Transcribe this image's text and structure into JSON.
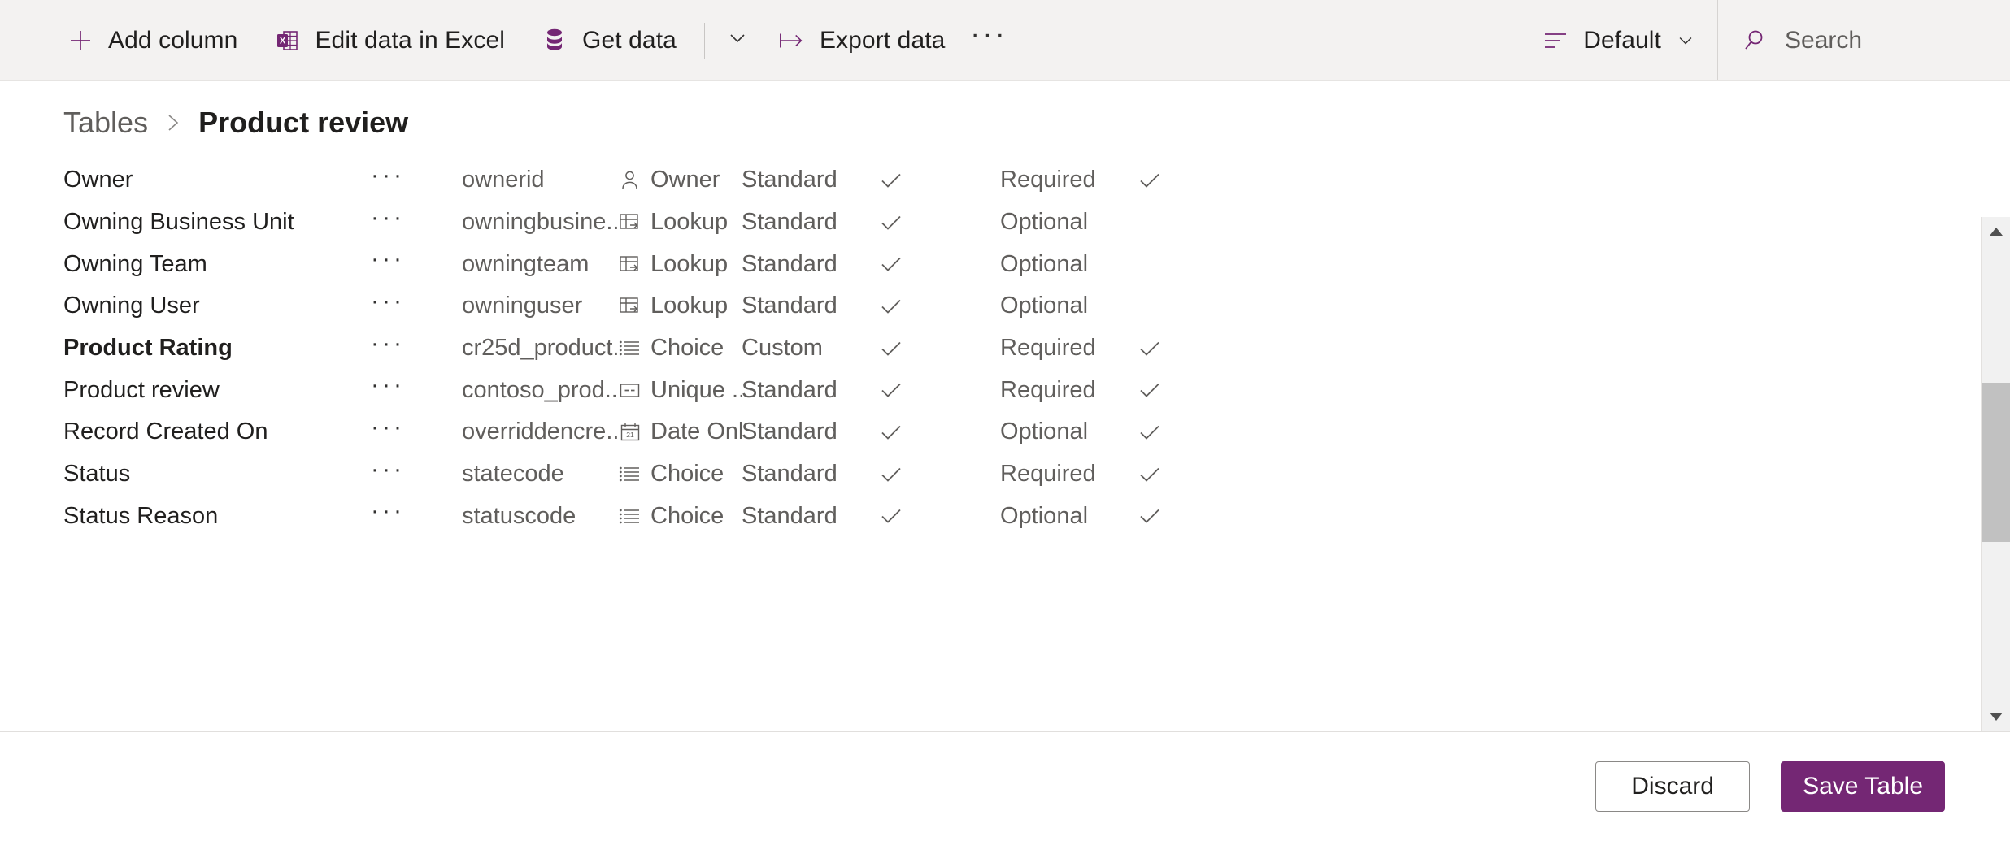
{
  "commandbar": {
    "add_column": "Add column",
    "edit_excel": "Edit data in Excel",
    "get_data": "Get data",
    "export_data": "Export data",
    "overflow": "···",
    "view_label": "Default",
    "search_placeholder": "Search"
  },
  "breadcrumb": {
    "root": "Tables",
    "separator": "›",
    "current": "Product review"
  },
  "grid": {
    "rows": [
      {
        "display_name": "Owner",
        "bold": false,
        "menu": "···",
        "logical_name": "ownerid",
        "data_type": "Owner",
        "type_icon": "person-icon",
        "custom_type": "Standard",
        "check1": true,
        "required": "Required",
        "check2": true
      },
      {
        "display_name": "Owning Business Unit",
        "bold": false,
        "menu": "···",
        "logical_name": "owningbusine...",
        "data_type": "Lookup",
        "type_icon": "lookup-icon",
        "custom_type": "Standard",
        "check1": true,
        "required": "Optional",
        "check2": false
      },
      {
        "display_name": "Owning Team",
        "bold": false,
        "menu": "···",
        "logical_name": "owningteam",
        "data_type": "Lookup",
        "type_icon": "lookup-icon",
        "custom_type": "Standard",
        "check1": true,
        "required": "Optional",
        "check2": false
      },
      {
        "display_name": "Owning User",
        "bold": false,
        "menu": "···",
        "logical_name": "owninguser",
        "data_type": "Lookup",
        "type_icon": "lookup-icon",
        "custom_type": "Standard",
        "check1": true,
        "required": "Optional",
        "check2": false
      },
      {
        "display_name": "Product Rating",
        "bold": true,
        "menu": "···",
        "logical_name": "cr25d_product...",
        "data_type": "Choice",
        "type_icon": "choice-icon",
        "custom_type": "Custom",
        "check1": true,
        "required": "Required",
        "check2": true
      },
      {
        "display_name": "Product review",
        "bold": false,
        "menu": "···",
        "logical_name": "contoso_prod...",
        "data_type": "Unique ...",
        "type_icon": "unique-identifier-icon",
        "custom_type": "Standard",
        "check1": true,
        "required": "Required",
        "check2": true
      },
      {
        "display_name": "Record Created On",
        "bold": false,
        "menu": "···",
        "logical_name": "overriddencre...",
        "data_type": "Date Only",
        "type_icon": "calendar-icon",
        "custom_type": "Standard",
        "check1": true,
        "required": "Optional",
        "check2": true
      },
      {
        "display_name": "Status",
        "bold": false,
        "menu": "···",
        "logical_name": "statecode",
        "data_type": "Choice",
        "type_icon": "choice-icon",
        "custom_type": "Standard",
        "check1": true,
        "required": "Required",
        "check2": true
      },
      {
        "display_name": "Status Reason",
        "bold": false,
        "menu": "···",
        "logical_name": "statuscode",
        "data_type": "Choice",
        "type_icon": "choice-icon",
        "custom_type": "Standard",
        "check1": true,
        "required": "Optional",
        "check2": true
      }
    ]
  },
  "footer": {
    "discard": "Discard",
    "save": "Save Table"
  },
  "colors": {
    "accent": "#742774",
    "commandbar_bg": "#f3f2f1",
    "text_primary": "#201f1e",
    "text_secondary": "#605e5c"
  }
}
